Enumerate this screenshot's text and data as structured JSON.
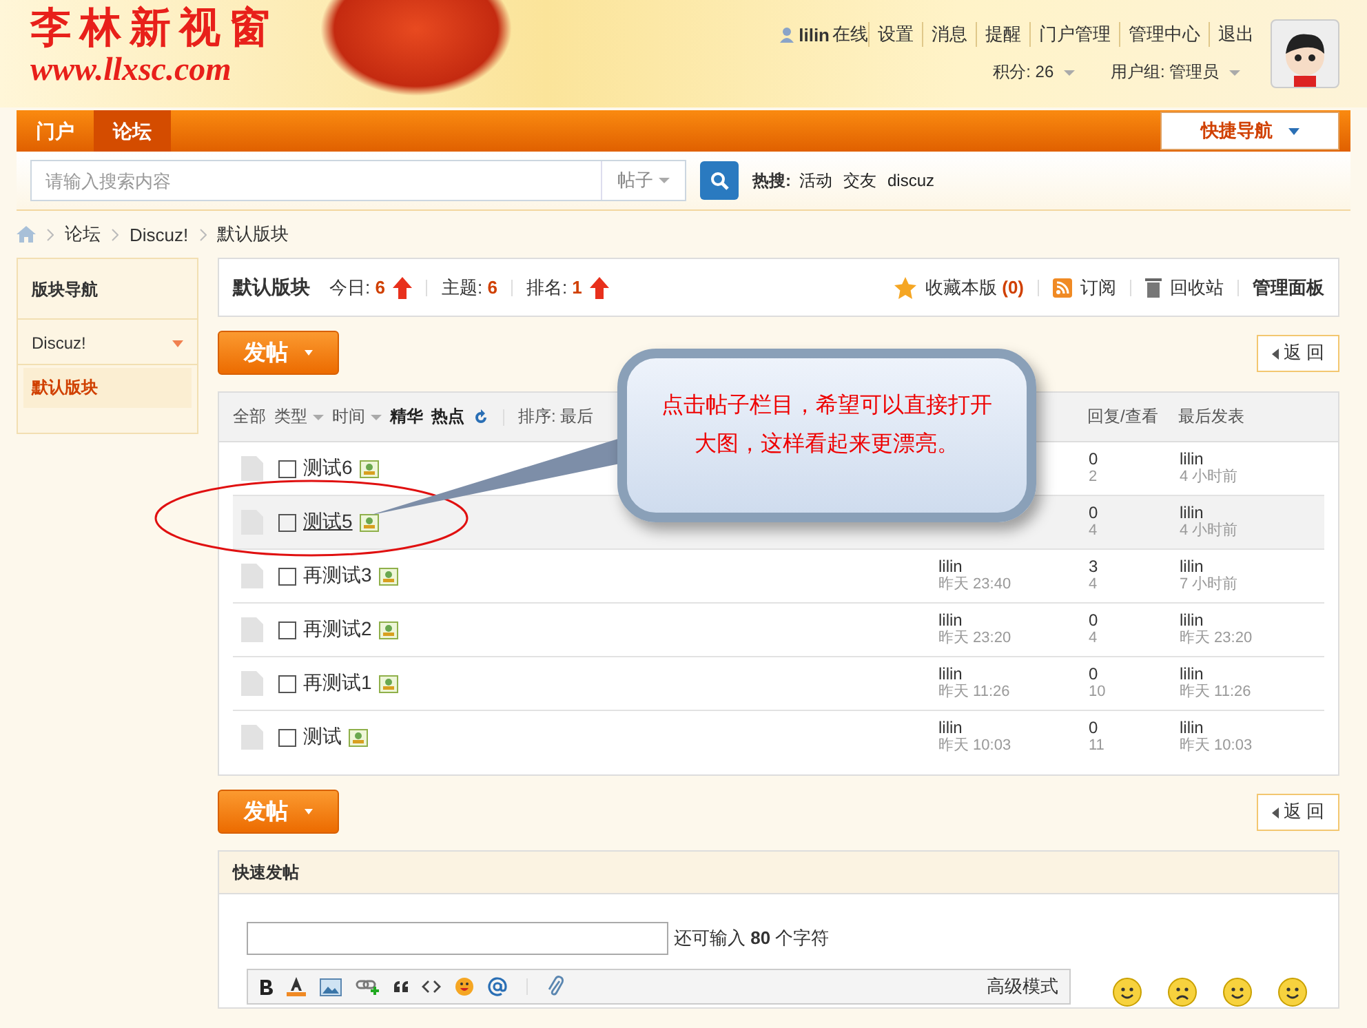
{
  "header": {
    "logo_title": "李林新视窗",
    "logo_url": "www.llxsc.com",
    "username": "lilin",
    "status": "在线",
    "links": [
      "设置",
      "消息",
      "提醒",
      "门户管理",
      "管理中心",
      "退出"
    ],
    "points": "积分: 26",
    "group": "用户组: 管理员"
  },
  "nav": {
    "tabs": [
      {
        "label": "门户",
        "selected": false
      },
      {
        "label": "论坛",
        "selected": true
      }
    ],
    "quick_nav": "快捷导航"
  },
  "search": {
    "placeholder": "请输入搜索内容",
    "scope": "帖子",
    "hot_label": "热搜:",
    "hot": [
      "活动",
      "交友",
      "discuz"
    ]
  },
  "breadcrumb": [
    "论坛",
    "Discuz!",
    "默认版块"
  ],
  "sidebar": {
    "title": "版块导航",
    "groups": [
      {
        "label": "Discuz!",
        "expanded": true,
        "children": [
          {
            "label": "默认版块",
            "selected": true
          }
        ]
      }
    ]
  },
  "forum": {
    "name": "默认版块",
    "stats": [
      {
        "label": "今日:",
        "value": "6",
        "rising": true
      },
      {
        "label": "主题:",
        "value": "6",
        "rising": false
      },
      {
        "label": "排名:",
        "value": "1",
        "rising": true
      }
    ],
    "favorite": "收藏本版",
    "favorite_count": "(0)",
    "subscribe": "订阅",
    "recycle": "回收站",
    "manage": "管理面板"
  },
  "top_actions": {
    "post_button": "发帖",
    "back_button": "返 回"
  },
  "filters": {
    "items": [
      {
        "label": "全部",
        "kind": "plain"
      },
      {
        "label": "类型",
        "kind": "dropdown"
      },
      {
        "label": "时间",
        "kind": "dropdown"
      },
      {
        "label": "精华",
        "kind": "bold"
      },
      {
        "label": "热点",
        "kind": "bold"
      }
    ],
    "sort": "排序: 最后",
    "col_replies": "回复/查看",
    "col_last": "最后发表"
  },
  "threads": [
    {
      "title": "测试6",
      "selected": false,
      "replies": "0",
      "views": "2",
      "last_user": "lilin",
      "last_time": "4 小时前"
    },
    {
      "title": "测试5",
      "selected": true,
      "replies": "0",
      "views": "4",
      "last_user": "lilin",
      "last_time": "4 小时前"
    },
    {
      "title": "再测试3",
      "selected": false,
      "author": "lilin",
      "author_time": "昨天 23:40",
      "replies": "3",
      "views": "4",
      "last_user": "lilin",
      "last_time": "7 小时前"
    },
    {
      "title": "再测试2",
      "selected": false,
      "author": "lilin",
      "author_time": "昨天 23:20",
      "replies": "0",
      "views": "4",
      "last_user": "lilin",
      "last_time": "昨天 23:20"
    },
    {
      "title": "再测试1",
      "selected": false,
      "author": "lilin",
      "author_time": "昨天 11:26",
      "replies": "0",
      "views": "10",
      "last_user": "lilin",
      "last_time": "昨天 11:26"
    },
    {
      "title": "测试",
      "selected": false,
      "author": "lilin",
      "author_time": "昨天 10:03",
      "replies": "0",
      "views": "11",
      "last_user": "lilin",
      "last_time": "昨天 10:03"
    }
  ],
  "bottom_actions": {
    "post_button": "发帖",
    "back_button": "返 回"
  },
  "quick_post": {
    "title": "快速发帖",
    "remaining": "还可输入 **80** 个字符",
    "advanced": "高级模式"
  },
  "callout": {
    "text": "点击帖子栏目，希望可以直接打开大图，这样看起来更漂亮。"
  }
}
